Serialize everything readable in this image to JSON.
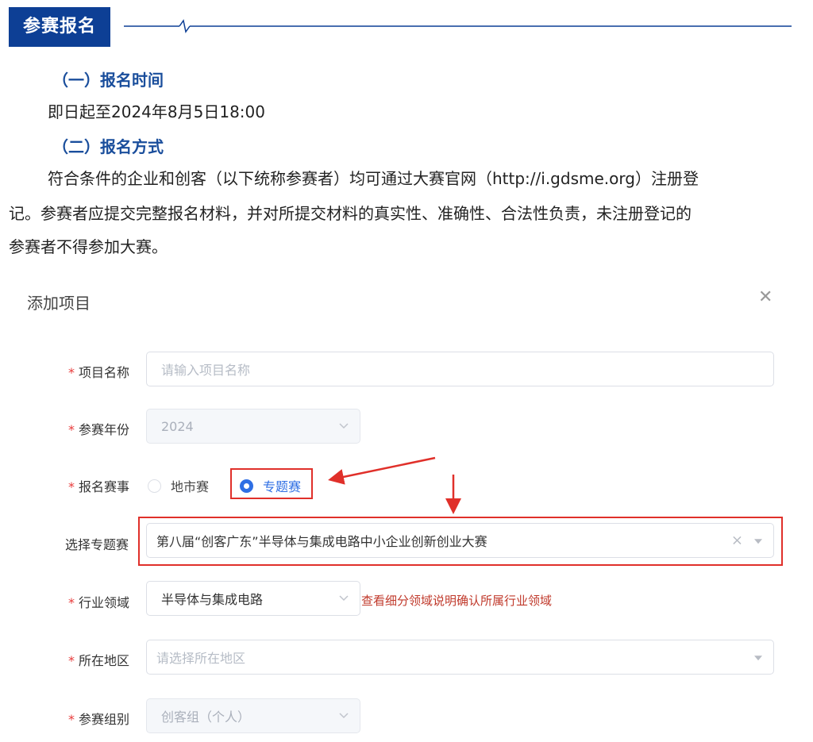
{
  "article": {
    "section_title": "参赛报名",
    "sub1": "（一）报名时间",
    "line1": "即日起至2024年8月5日18:00",
    "sub2": "（二）报名方式",
    "para_line1": "符合条件的企业和创客（以下统称参赛者）均可通过大赛官网（http://i.gdsme.org）注册登",
    "para_line2": "记。参赛者应提交完整报名材料，并对所提交材料的真实性、准确性、合法性负责，未注册登记的",
    "para_line3": "参赛者不得参加大赛。"
  },
  "dialog": {
    "title": "添加项目",
    "close_icon": "close-icon",
    "fields": {
      "project_name": {
        "label": "项目名称",
        "required": true,
        "placeholder": "请输入项目名称",
        "value": ""
      },
      "year": {
        "label": "参赛年份",
        "required": true,
        "value": "2024",
        "disabled": true
      },
      "event": {
        "label": "报名赛事",
        "required": true,
        "options": [
          "地市赛",
          "专题赛"
        ],
        "selected": "专题赛"
      },
      "special_event": {
        "label": "选择专题赛",
        "required": false,
        "value": "第八届“创客广东”半导体与集成电路中小企业创新创业大赛"
      },
      "industry": {
        "label": "行业领域",
        "required": true,
        "value": "半导体与集成电路",
        "help": "查看细分领域说明确认所属行业领域"
      },
      "region": {
        "label": "所在地区",
        "required": true,
        "placeholder": "请选择所在地区"
      },
      "group": {
        "label": "参赛组别",
        "required": true,
        "value": "创客组（个人）",
        "disabled": true
      }
    }
  },
  "colors": {
    "brand_blue": "#0d3f95",
    "subheading_blue": "#1a4e9c",
    "radio_blue": "#2f6fe4",
    "annotation_red": "#e0302a",
    "help_red": "#c0392b"
  }
}
